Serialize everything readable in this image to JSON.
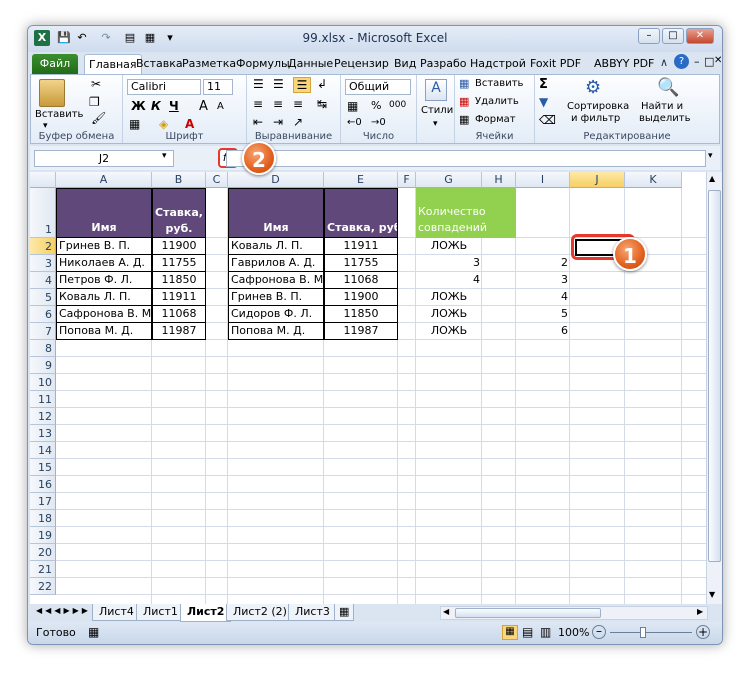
{
  "window": {
    "title": "99.xlsx - Microsoft Excel",
    "app_icon": "X"
  },
  "ribbon_tabs": [
    "Файл",
    "Главная",
    "Вставка",
    "Разметка",
    "Формулы",
    "Данные",
    "Рецензир",
    "Вид",
    "Разрабо",
    "Надстрой",
    "Foxit PDF",
    "ABBYY PDF"
  ],
  "ribbon": {
    "clipboard": {
      "paste": "Вставить",
      "label": "Буфер обмена"
    },
    "font": {
      "name": "Calibri",
      "size": "11",
      "bold": "Ж",
      "italic": "К",
      "underline": "Ч",
      "grow": "A",
      "shrink": "A",
      "label": "Шрифт"
    },
    "alignment": {
      "label": "Выравнивание"
    },
    "number": {
      "format": "Общий",
      "percent": "%",
      "thousands": "000",
      "label": "Число"
    },
    "styles": {
      "label": "Стили"
    },
    "cells": {
      "insert": "Вставить",
      "delete": "Удалить",
      "format": "Формат",
      "label": "Ячейки"
    },
    "editing": {
      "sigma": "Σ",
      "sort": "Сортировка",
      "sort2": "и фильтр",
      "find": "Найти и",
      "find2": "выделить",
      "label": "Редактирование"
    }
  },
  "formula_bar": {
    "name_box": "J2",
    "fx": "fx",
    "value": ""
  },
  "columns": [
    "A",
    "B",
    "C",
    "D",
    "E",
    "F",
    "G",
    "H",
    "I",
    "J",
    "K"
  ],
  "rows": [
    "1",
    "2",
    "3",
    "4",
    "5",
    "6",
    "7",
    "8",
    "9",
    "10",
    "11",
    "12",
    "13",
    "14",
    "15",
    "16",
    "17",
    "18",
    "19",
    "20",
    "21",
    "22"
  ],
  "table1": {
    "h_name": "Имя",
    "h_rate1": "Ставка,",
    "h_rate2": "руб.",
    "rows": [
      [
        "Гринев В. П.",
        "11900"
      ],
      [
        "Николаев А. Д.",
        "11755"
      ],
      [
        "Петров Ф. Л.",
        "11850"
      ],
      [
        "Коваль Л. П.",
        "11911"
      ],
      [
        "Сафронова В. М.",
        "11068"
      ],
      [
        "Попова М. Д.",
        "11987"
      ]
    ]
  },
  "table2": {
    "h_name": "Имя",
    "h_rate": "Ставка, руб.",
    "rows": [
      [
        "Коваль Л. П.",
        "11911"
      ],
      [
        "Гаврилов А. Д.",
        "11755"
      ],
      [
        "Сафронова В. М.",
        "11068"
      ],
      [
        "Гринев В. П.",
        "11900"
      ],
      [
        "Сидоров Ф. Л.",
        "11850"
      ],
      [
        "Попова М. Д.",
        "11987"
      ]
    ]
  },
  "match": {
    "h1": "Количество",
    "h2": "совпадений",
    "g": [
      "ЛОЖЬ",
      "3",
      "4",
      "ЛОЖЬ",
      "ЛОЖЬ",
      "ЛОЖЬ"
    ],
    "i": [
      "",
      "2",
      "3",
      "4",
      "5",
      "6"
    ]
  },
  "sheets": [
    "Лист4",
    "Лист1",
    "Лист2",
    "Лист2 (2)",
    "Лист3"
  ],
  "active_sheet": "Лист2",
  "status": {
    "ready": "Готово",
    "zoom": "100%"
  },
  "callouts": [
    "1",
    "2"
  ],
  "colors": {
    "header_purple": "#60497a",
    "green": "#92d050",
    "callout": "#e2601f"
  }
}
